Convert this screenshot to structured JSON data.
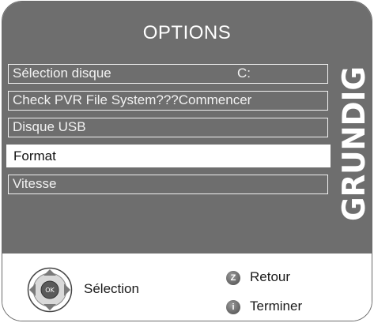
{
  "menu": {
    "title": "OPTIONS",
    "items": [
      {
        "label": "Sélection disque",
        "value": "C:"
      },
      {
        "label": "Check PVR File System???Commencer",
        "value": ""
      },
      {
        "label": "Disque USB",
        "value": ""
      },
      {
        "label": "Format",
        "value": "",
        "selected": true
      },
      {
        "label": "Vitesse",
        "value": ""
      }
    ]
  },
  "brand": {
    "logo_text": "GRUNDIG"
  },
  "footer": {
    "nav_center": "OK",
    "nav_label": "Sélection",
    "back_key": "Z",
    "back_label": "Retour",
    "exit_key": "i",
    "exit_label": "Terminer"
  },
  "colors": {
    "panel": "#6e6e6e",
    "highlight": "#ffffff",
    "footer": "#ffffff"
  }
}
